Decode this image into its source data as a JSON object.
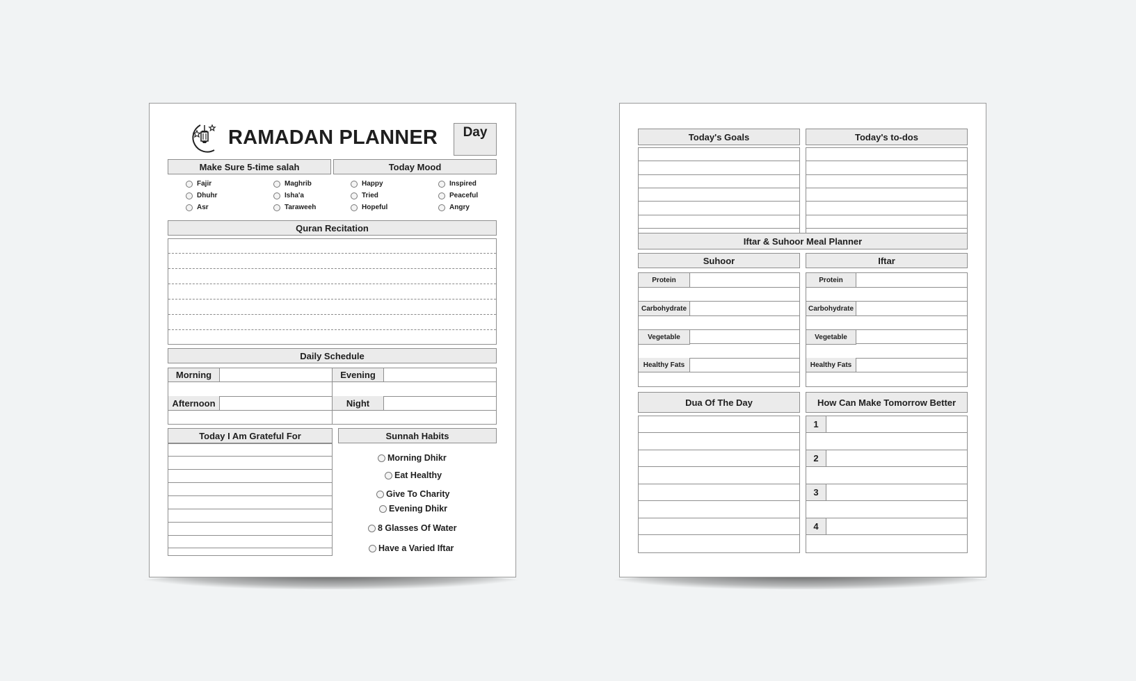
{
  "left_page": {
    "title": "RAMADAN PLANNER",
    "logo_icon": "crescent-moon-lantern-icon",
    "day_label": "Day",
    "salah": {
      "header": "Make Sure 5-time salah",
      "options": [
        "Fajir",
        "Dhuhr",
        "Asr",
        "Maghrib",
        "Isha'a",
        "Taraweeh"
      ]
    },
    "mood": {
      "header": "Today Mood",
      "options": [
        "Happy",
        "Tried",
        "Hopeful",
        "Inspired",
        "Peaceful",
        "Angry"
      ]
    },
    "quran": {
      "header": "Quran Recitation"
    },
    "schedule": {
      "header": "Daily Schedule",
      "slots": [
        "Morning",
        "Evening",
        "Afternoon",
        "Night"
      ]
    },
    "grateful": {
      "header": "Today I Am Grateful For"
    },
    "sunnah": {
      "header": "Sunnah Habits",
      "habits": [
        "Morning Dhikr",
        "Eat Healthy",
        "Give To Charity",
        "Evening Dhikr",
        "8 Glasses Of Water",
        "Have a Varied Iftar"
      ]
    }
  },
  "right_page": {
    "goals": {
      "header": "Today's Goals"
    },
    "todos": {
      "header": "Today's to-dos"
    },
    "meal_planner": {
      "header": "Iftar & Suhoor Meal Planner",
      "suhoor": {
        "header": "Suhoor",
        "rows": [
          "Protein",
          "Carbohydrate",
          "Vegetable",
          "Healthy Fats"
        ]
      },
      "iftar": {
        "header": "Iftar",
        "rows": [
          "Protein",
          "Carbohydrate",
          "Vegetable",
          "Healthy Fats"
        ]
      }
    },
    "dua": {
      "header": "Dua Of The Day"
    },
    "tomorrow": {
      "header": "How Can Make Tomorrow Better",
      "numbers": [
        "1",
        "2",
        "3",
        "4"
      ]
    }
  }
}
